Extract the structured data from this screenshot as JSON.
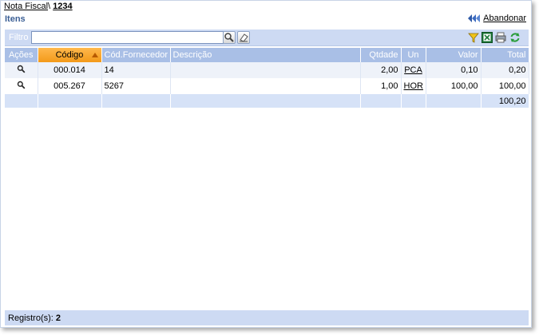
{
  "breadcrumb": {
    "parent": "Nota Fiscal",
    "separator": "\\",
    "current": "1234"
  },
  "section_title": "Itens",
  "back_label": "Abandonar",
  "filter": {
    "label": "Filtro",
    "value": ""
  },
  "columns": [
    "Ações",
    "Código",
    "Cód.Fornecedor",
    "Descrição",
    "Qtdade",
    "Un",
    "Valor",
    "Total"
  ],
  "rows": [
    {
      "codigo": "000.014",
      "cod_fornecedor": "14",
      "descricao": "",
      "qtdade": "2,00",
      "un": "PCA",
      "valor": "0,10",
      "total": "0,20"
    },
    {
      "codigo": "005.267",
      "cod_fornecedor": "5267",
      "descricao": "",
      "qtdade": "1,00",
      "un": "HOR",
      "valor": "100,00",
      "total": "100,00"
    }
  ],
  "grand_total": "100,20",
  "footer": {
    "label": "Registro(s):",
    "count": "2"
  },
  "colors": {
    "accent": "#3a5e94",
    "header": "#a9bfe6",
    "sorted_header": "#f39a1a",
    "bar": "#cddaf3"
  },
  "icons": [
    "search-icon",
    "clear-icon",
    "filter-icon",
    "excel-icon",
    "print-icon",
    "refresh-icon",
    "back-arrows-icon"
  ]
}
